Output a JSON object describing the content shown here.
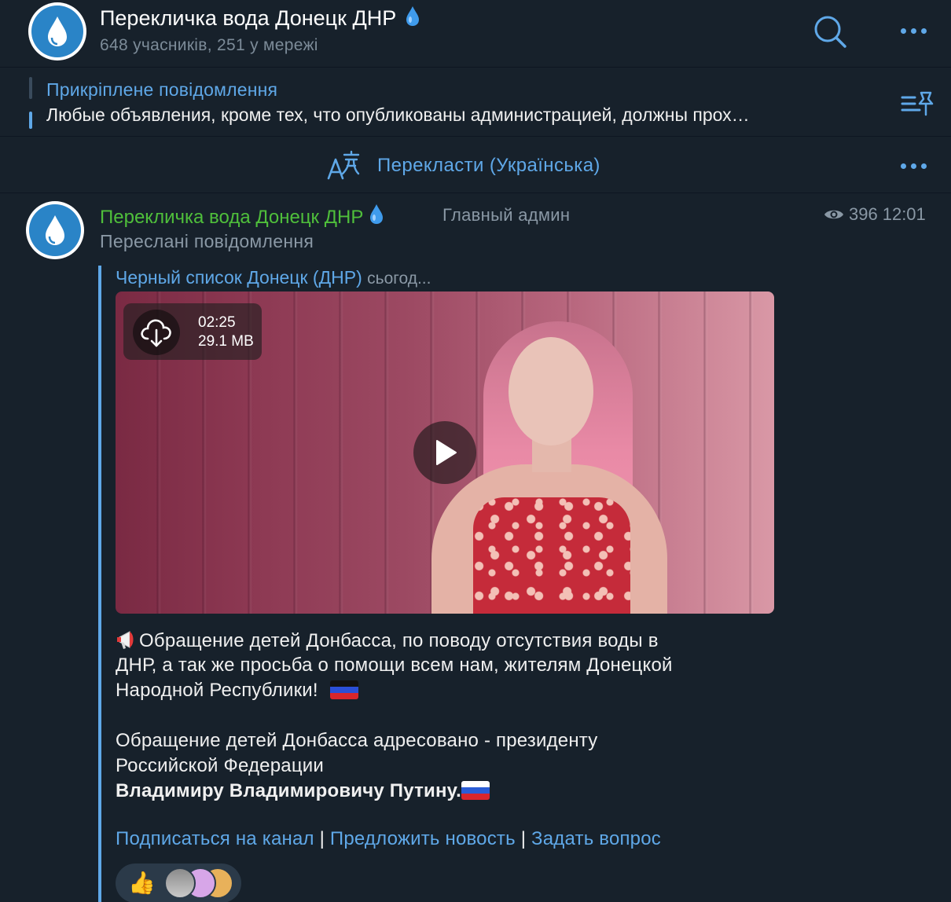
{
  "header": {
    "title": "Перекличка вода Донецк ДНР",
    "subtitle": "648 учасників, 251 у мережі"
  },
  "pinned": {
    "title": "Прикріплене повідомлення",
    "text": "Любые объявления, кроме тех, что опубликованы администрацией, должны прох…"
  },
  "translate": {
    "label": "Перекласти (Українська)"
  },
  "message": {
    "author": "Перекличка вода Донецк ДНР",
    "rank": "Главный админ",
    "views": "396",
    "time": "12:01",
    "forward_label": "Переслані повідомлення",
    "forward_source": "Черный список Донецк (ДНР)",
    "forward_date": "сьогод...",
    "video": {
      "duration": "02:25",
      "size": "29.1 MB"
    },
    "text": {
      "line1": "Обращение детей Донбасса, по поводу отсутствия воды в",
      "line2": "ДНР, а так же просьба о помощи всем нам, жителям Донецкой",
      "line3": "Народной Республики!",
      "line4": "Обращение детей Донбасса адресовано - президенту",
      "line5": "Российской Федерации",
      "line6": "Владимиру Владимировичу Путину."
    },
    "links": {
      "subscribe": "Подписаться на канал",
      "suggest": "Предложить новость",
      "ask": "Задать вопрос",
      "separator": "|"
    },
    "reaction": {
      "emoji": "👍"
    }
  },
  "colors": {
    "background": "#17212b",
    "accent": "#5fa8e8",
    "author": "#4fbf3b",
    "muted": "#8a98a5"
  }
}
